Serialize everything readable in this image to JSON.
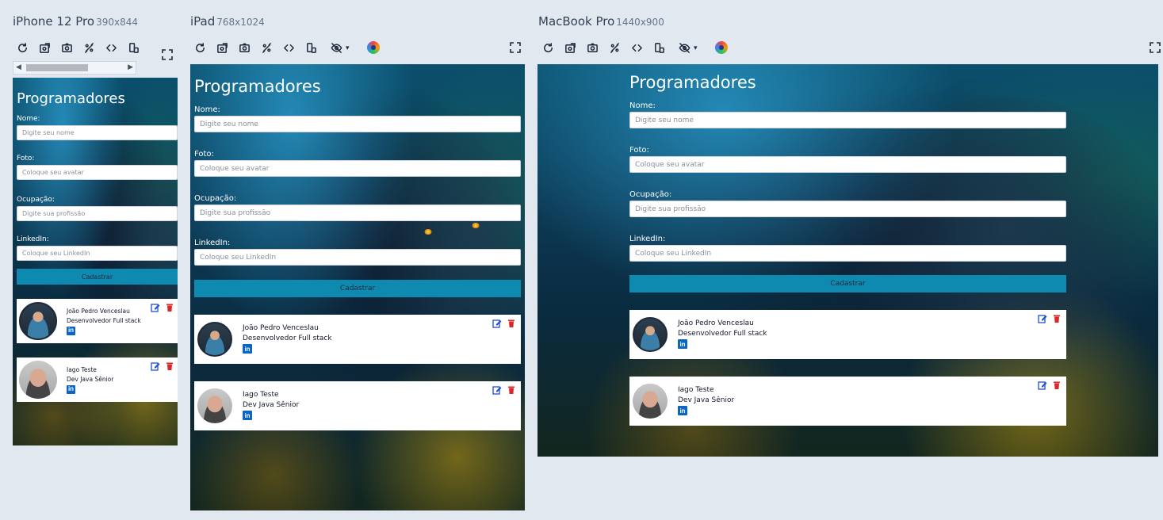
{
  "devices": [
    {
      "name": "iPhone 12 Pro",
      "dims": "390x844"
    },
    {
      "name": "iPad",
      "dims": "768x1024"
    },
    {
      "name": "MacBook Pro",
      "dims": "1440x900"
    }
  ],
  "toolbar": {
    "icons": [
      "refresh-icon",
      "rotate-icon",
      "screenshot-icon",
      "throttle-icon",
      "code-icon",
      "device-switch-icon",
      "hide-icon",
      "color-picker-icon",
      "fullscreen-icon"
    ]
  },
  "app": {
    "title": "Programadores",
    "fields": [
      {
        "label": "Nome:",
        "placeholder": "Digite seu nome"
      },
      {
        "label": "Foto:",
        "placeholder": "Coloque seu avatar"
      },
      {
        "label": "Ocupação:",
        "placeholder": "Digite sua profissão"
      },
      {
        "label": "LinkedIn:",
        "placeholder": "Coloque seu LinkedIn"
      }
    ],
    "submit_label": "Cadastrar",
    "programmers": [
      {
        "name": "João Pedro Venceslau",
        "role": "Desenvolvedor Full stack",
        "linkedin": "in"
      },
      {
        "name": "Iago Teste",
        "role": "Dev Java Sênior",
        "linkedin": "in"
      }
    ]
  },
  "colors": {
    "accent": "#0e8ab0",
    "edit": "#1d4ed8",
    "delete": "#dc2626",
    "linkedin": "#0a66c2"
  }
}
